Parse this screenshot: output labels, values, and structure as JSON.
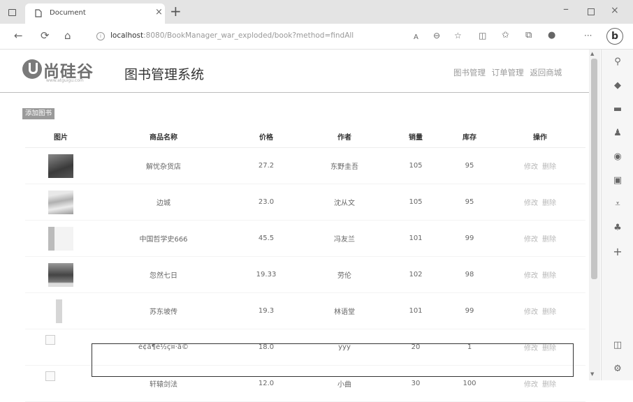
{
  "browser": {
    "tab_title": "Document",
    "tab_close": "×",
    "new_tab": "+",
    "address_host": "localhost",
    "address_rest": ":8080/BookManager_war_exploded/book?method=findAll",
    "window_buttons": {
      "minimize": "–",
      "close": "×"
    }
  },
  "header": {
    "logo_text": "尚硅谷",
    "logo_sub": "www.atguigu.com",
    "system_title": "图书管理系统",
    "links": [
      "图书管理",
      "订单管理",
      "返回商城"
    ]
  },
  "add_button": "添加图书",
  "table": {
    "columns": [
      "图片",
      "商品名称",
      "价格",
      "作者",
      "销量",
      "库存",
      "操作"
    ],
    "ops": [
      "修改",
      "删除"
    ],
    "rows": [
      {
        "name": "解忧杂货店",
        "price": "27.2",
        "author": "东野圭吾",
        "sales": "105",
        "stock": "95"
      },
      {
        "name": "边城",
        "price": "23.0",
        "author": "沈从文",
        "sales": "105",
        "stock": "95"
      },
      {
        "name": "中国哲学史666",
        "price": "45.5",
        "author": "冯友兰",
        "sales": "101",
        "stock": "99"
      },
      {
        "name": "忽然七日",
        "price": "19.33",
        "author": "劳伦",
        "sales": "102",
        "stock": "98"
      },
      {
        "name": "苏东坡传",
        "price": "19.3",
        "author": "林语堂",
        "sales": "101",
        "stock": "99"
      },
      {
        "name": "è¢ã¶è½ç¤·ã©",
        "price": "18.0",
        "author": "yyy",
        "sales": "20",
        "stock": "1"
      },
      {
        "name": "轩辕剑法",
        "price": "12.0",
        "author": "小曲",
        "sales": "30",
        "stock": "100"
      }
    ]
  },
  "colors": {
    "accent": "#9a9a9a",
    "highlight_border": "#333333"
  }
}
